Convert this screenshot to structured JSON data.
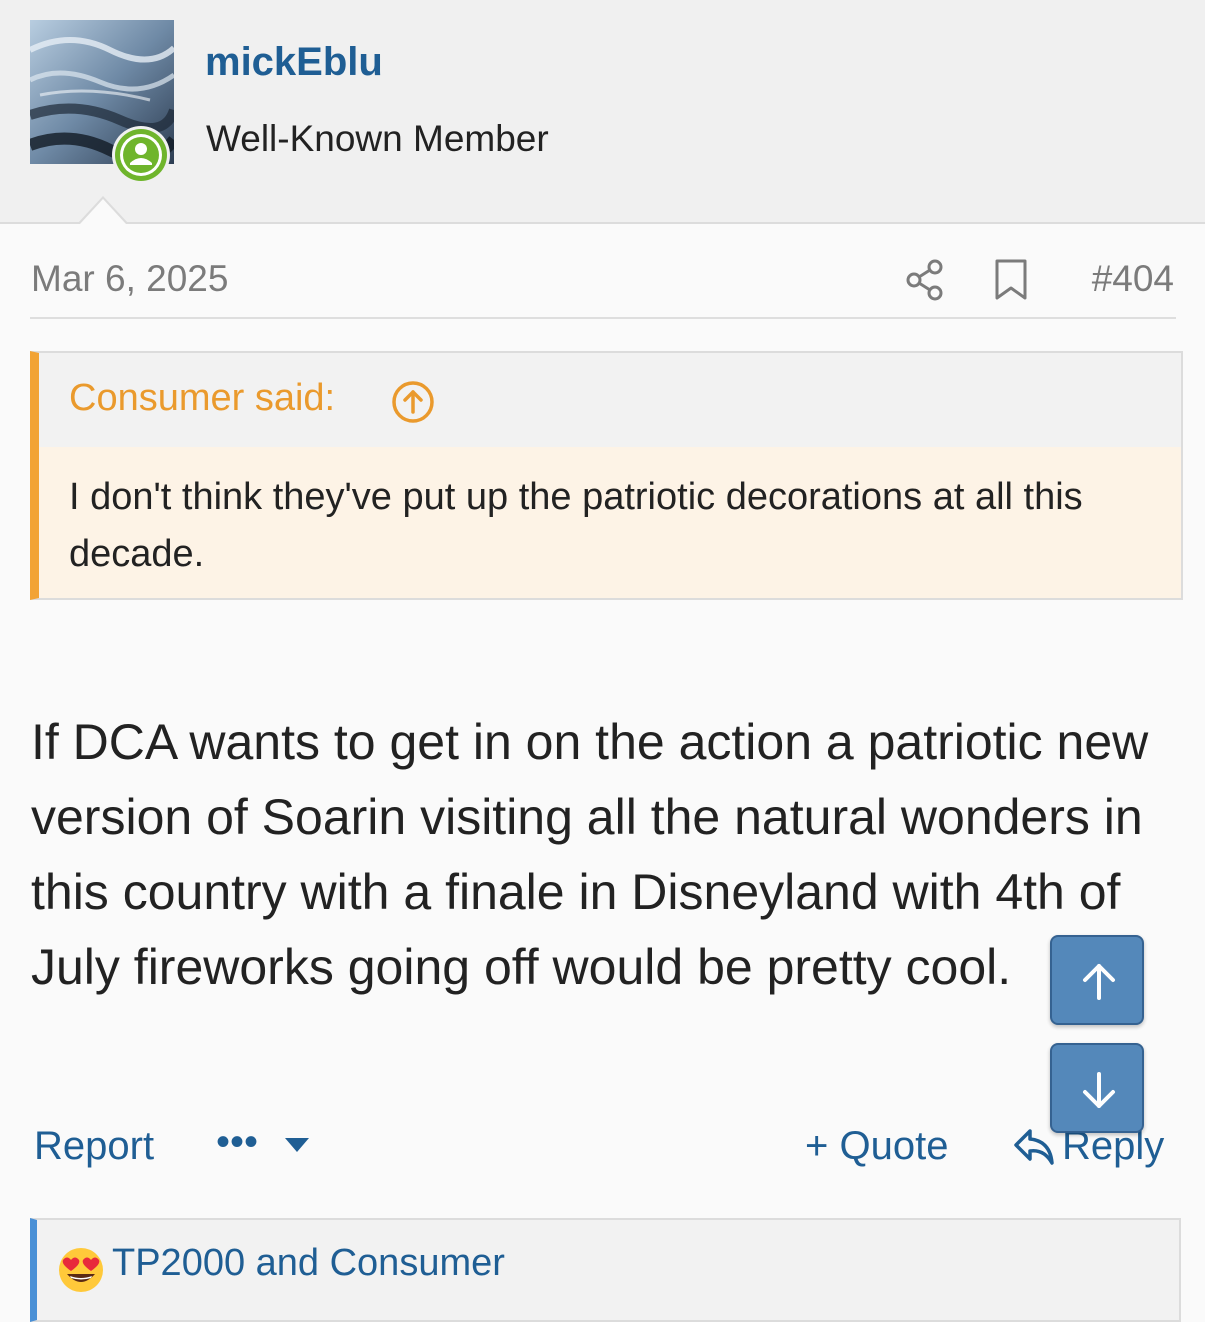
{
  "author": {
    "username": "mickEblu",
    "title": "Well-Known Member",
    "online": true
  },
  "post": {
    "date": "Mar 6, 2025",
    "number": "#404",
    "quote": {
      "author_line": "Consumer said:",
      "text": "I don't think they've put up the patriotic decorations at all this decade."
    },
    "body": "If DCA wants to get in on the action a patriotic new version of Soarin visiting all the natural wonders in this country with a finale in Disneyland with 4th of July fireworks going off would be pretty cool."
  },
  "actions": {
    "report": "Report",
    "more": "•••",
    "quote": "+ Quote",
    "reply": "Reply"
  },
  "reactions": {
    "text": "TP2000 and Consumer",
    "emoji": "heart-eyes-emoji"
  },
  "icons": {
    "share": "share-icon",
    "bookmark": "bookmark-icon",
    "quote_jump": "arrow-up-circle-icon",
    "scroll_up": "arrow-up-icon",
    "scroll_down": "arrow-down-icon"
  },
  "colors": {
    "link": "#1f5e94",
    "quote_accent": "#f2a334",
    "online": "#6fb52c",
    "scroll_button": "#4f85b8",
    "reaction_accent": "#4a90d6"
  }
}
